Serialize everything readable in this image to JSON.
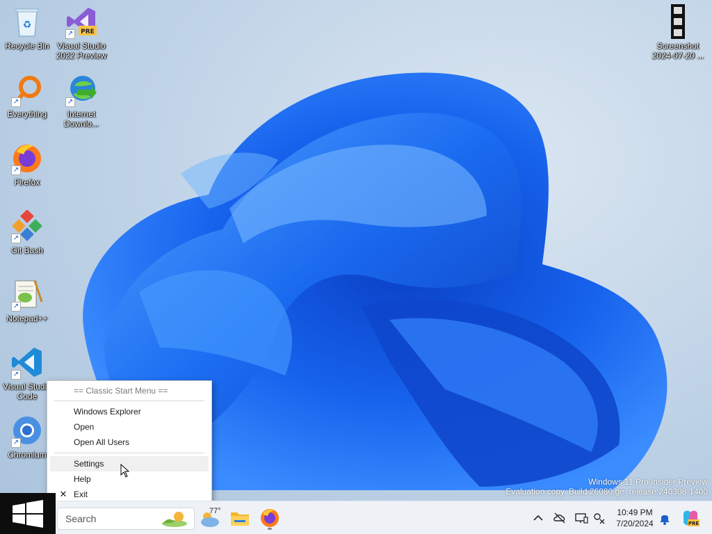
{
  "desktop_icons": [
    {
      "label": "Recycle Bin",
      "icon": "recycle-bin-icon"
    },
    {
      "label": "Visual Studio 2022 Preview",
      "icon": "visual-studio-icon"
    },
    {
      "label": "Everything",
      "icon": "everything-search-icon"
    },
    {
      "label": "Internet Downlo...",
      "icon": "internet-download-manager-icon"
    },
    {
      "label": "Firefox",
      "icon": "firefox-icon"
    },
    {
      "label": "Git Bash",
      "icon": "git-bash-icon"
    },
    {
      "label": "Notepad++",
      "icon": "notepad-plus-plus-icon"
    },
    {
      "label": "Visual Studio Code",
      "icon": "vscode-icon"
    },
    {
      "label": "Chromium",
      "icon": "chromium-icon"
    },
    {
      "label": "Screenshot 2024-07-20 ...",
      "icon": "screenshot-file-icon"
    }
  ],
  "vs_badge": "PRE",
  "context_menu": {
    "header": "== Classic Start Menu ==",
    "items": [
      "Windows Explorer",
      "Open",
      "Open All Users",
      "Settings",
      "Help",
      "Exit"
    ],
    "exit_check": "✕"
  },
  "watermark": {
    "line1": "Windows 11 Pro Insider Preview",
    "line2": "Evaluation copy. Build 26080.ge_release.240308-1400"
  },
  "taskbar": {
    "search_placeholder": "Search",
    "weather_temp": "77°",
    "apps": [
      "file-explorer-icon",
      "firefox-icon"
    ],
    "tray": [
      "chevron-up-icon",
      "onedrive-offline-icon",
      "display-icon",
      "network-icon",
      "notification-bell-icon",
      "copilot-icon"
    ]
  },
  "clock": {
    "time": "10:49 PM",
    "date": "7/20/2024"
  },
  "colors": {
    "bloom": "#1a6cf0",
    "start_bg": "#0d0d0d",
    "taskbar_bg": "#eef2f7"
  }
}
